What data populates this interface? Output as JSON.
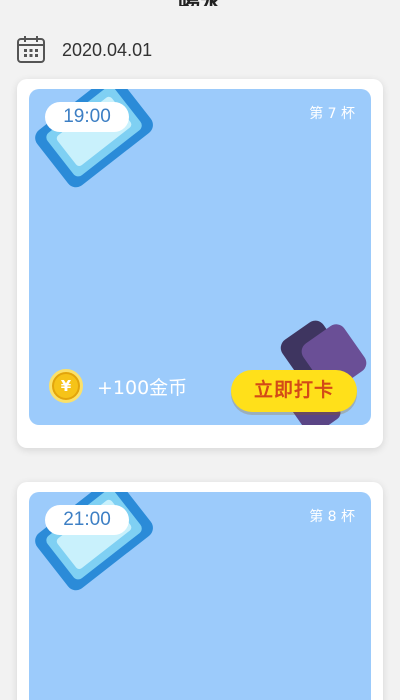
{
  "header": {
    "title": "喝水"
  },
  "date": {
    "value": "2020.04.01",
    "icon": "calendar-icon"
  },
  "cards": [
    {
      "time": "19:00",
      "count": "第 7 杯",
      "reward": "+100金币",
      "coin_symbol": "¥",
      "button": "立即打卡"
    },
    {
      "time": "21:00",
      "count": "第 8 杯"
    }
  ],
  "colors": {
    "panel": "#9ccbfb",
    "button": "#ffe01a",
    "button_text": "#d34a17",
    "coin": "#f6c318"
  }
}
